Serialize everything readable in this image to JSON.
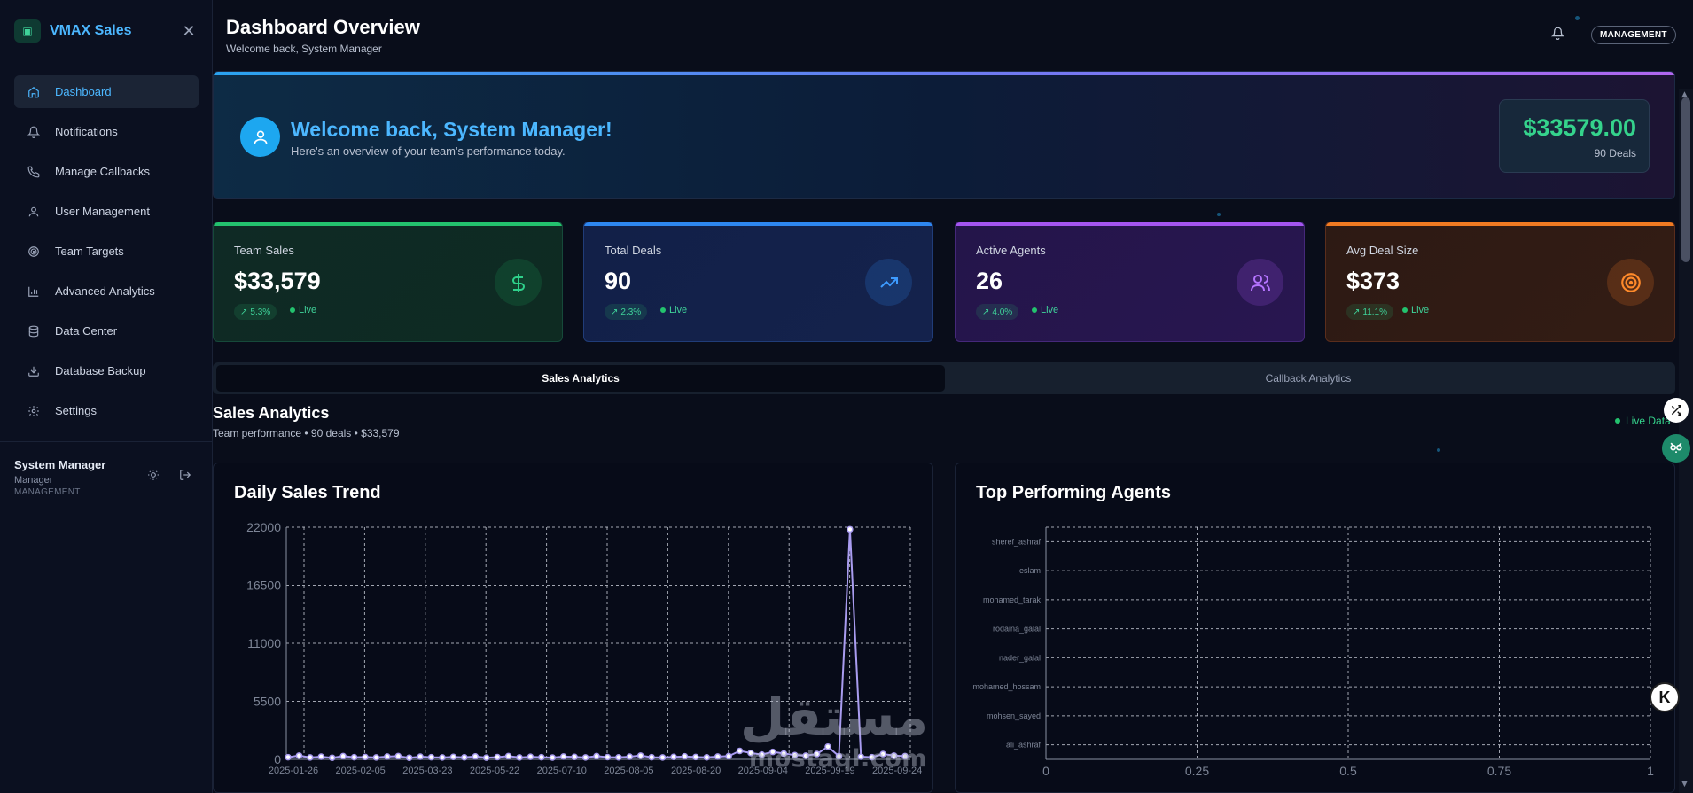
{
  "sidebar": {
    "brand": "VMAX Sales",
    "items": [
      {
        "label": "Dashboard",
        "icon": "home-icon"
      },
      {
        "label": "Notifications",
        "icon": "bell-icon"
      },
      {
        "label": "Manage Callbacks",
        "icon": "phone-icon"
      },
      {
        "label": "User Management",
        "icon": "user-icon"
      },
      {
        "label": "Team Targets",
        "icon": "target-icon"
      },
      {
        "label": "Advanced Analytics",
        "icon": "bar-chart-icon"
      },
      {
        "label": "Data Center",
        "icon": "database-icon"
      },
      {
        "label": "Database Backup",
        "icon": "download-icon"
      },
      {
        "label": "Settings",
        "icon": "gear-icon"
      }
    ],
    "user": {
      "name": "System Manager",
      "role": "Manager",
      "org": "MANAGEMENT"
    }
  },
  "header": {
    "title": "Dashboard Overview",
    "subtitle": "Welcome back, System Manager",
    "badge": "MANAGEMENT"
  },
  "welcome": {
    "title": "Welcome back, System Manager!",
    "subtitle": "Here's an overview of your team's performance today.",
    "amount": "$33579.00",
    "deals": "90 Deals"
  },
  "kpis": [
    {
      "label": "Team Sales",
      "value": "$33,579",
      "trend": "5.3%",
      "live": "Live",
      "icon": "dollar-icon",
      "accent": "#23c26e"
    },
    {
      "label": "Total Deals",
      "value": "90",
      "trend": "2.3%",
      "live": "Live",
      "icon": "trending-up-icon",
      "accent": "#2e87f0"
    },
    {
      "label": "Active Agents",
      "value": "26",
      "trend": "4.0%",
      "live": "Live",
      "icon": "users-icon",
      "accent": "#a455f0"
    },
    {
      "label": "Avg Deal Size",
      "value": "$373",
      "trend": "11.1%",
      "live": "Live",
      "icon": "target-icon",
      "accent": "#f07a22"
    }
  ],
  "tabs": [
    {
      "label": "Sales Analytics",
      "active": true
    },
    {
      "label": "Callback Analytics",
      "active": false
    }
  ],
  "section": {
    "title": "Sales Analytics",
    "subtitle": "Team performance • 90 deals • $33,579",
    "live": "Live Data"
  },
  "watermark": {
    "arabic": "مستقل",
    "latin": "mostaql.com"
  },
  "chart_data": [
    {
      "type": "line",
      "title": "Daily Sales Trend",
      "x_ticks": [
        "2025-01-26",
        "2025-02-05",
        "2025-03-23",
        "2025-05-22",
        "2025-07-10",
        "2025-08-05",
        "2025-08-20",
        "2025-09-04",
        "2025-09-19",
        "2025-09-24"
      ],
      "y_ticks": [
        0,
        5500,
        11000,
        16500,
        22000
      ],
      "ylim": [
        0,
        22000
      ],
      "grid": true,
      "series": [
        {
          "color": "#a99cf0",
          "values": [
            200,
            350,
            180,
            250,
            150,
            300,
            200,
            220,
            180,
            260,
            300,
            150,
            250,
            200,
            180,
            230,
            190,
            270,
            160,
            210,
            300,
            180,
            240,
            200,
            170,
            260,
            230,
            180,
            300,
            210,
            190,
            250,
            350,
            200,
            180,
            230,
            280,
            220,
            190,
            260,
            300,
            800,
            600,
            450,
            700,
            550,
            400,
            350,
            500,
            1200,
            300,
            21800,
            250,
            200,
            500,
            350,
            300
          ]
        }
      ]
    },
    {
      "type": "bar",
      "orientation": "horizontal",
      "title": "Top Performing Agents",
      "categories": [
        "sheref_ashraf",
        "eslam",
        "mohamed_tarak",
        "rodaina_galal",
        "nader_galal",
        "mohamed_hossam",
        "mohsen_sayed",
        "ali_ashraf"
      ],
      "values": [
        0,
        0,
        0,
        0,
        0,
        0,
        0,
        0
      ],
      "x_ticks": [
        "0",
        "0.25",
        "0.5",
        "0.75",
        "1"
      ],
      "xlim": [
        0,
        1
      ],
      "grid": true
    }
  ]
}
